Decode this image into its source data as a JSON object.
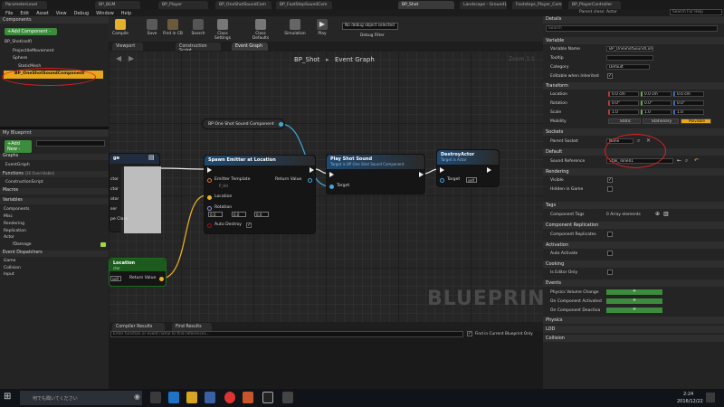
{
  "doc_tabs": [
    {
      "label": "ParameterLevel"
    },
    {
      "label": "BP_BGM"
    },
    {
      "label": "BP_Player"
    },
    {
      "label": "BP_OneShotSoundCom"
    },
    {
      "label": "BP_FootStepSoundCom"
    },
    {
      "label": "BP_Shot"
    },
    {
      "label": "Landscape - Ground1"
    },
    {
      "label": "Footsteps_Player_Comb"
    },
    {
      "label": "BP_PlayerController"
    }
  ],
  "parent_class": "Parent class: Actor",
  "search_placeholder": "Search For Help",
  "menu": [
    "File",
    "Edit",
    "Asset",
    "View",
    "Debug",
    "Window",
    "Help"
  ],
  "components_panel": {
    "title": "Components",
    "add_label": "+Add Component -",
    "root_label": "BP_Shot(self)",
    "items": [
      "ProjectileMovement",
      "Sphere",
      "StaticMesh",
      "BP_OneShotSoundComponent"
    ]
  },
  "my_blueprint": {
    "title": "My Blueprint",
    "add_label": "+Add New -",
    "graphs_label": "Graphs",
    "event_graph": "EventGraph",
    "functions_label": "Functions",
    "functions_note": "(26 Overridable)",
    "construction_script": "ConstructionScript",
    "macros_label": "Macros",
    "variables_label": "Variables",
    "var_categories": [
      "Components",
      "Misc",
      "Rendering",
      "Replication",
      "Actor"
    ],
    "var_item": "fDamage",
    "event_dispatchers_label": "Event Dispatchers",
    "ed_categories": [
      "Game",
      "Collision",
      "Input"
    ]
  },
  "toolbar": [
    {
      "label": "Compile"
    },
    {
      "label": "Save"
    },
    {
      "label": "Find in CB"
    },
    {
      "label": "Search"
    },
    {
      "label": "Class Settings"
    },
    {
      "label": "Class Defaults"
    },
    {
      "label": "Simulation"
    },
    {
      "label": "Play"
    }
  ],
  "debug_select": "No debug object selected",
  "debug_filter": "Debug Filter",
  "graph_tabs": [
    "Viewport",
    "Construction Script",
    "Event Graph"
  ],
  "breadcrumb": {
    "blueprint": "BP_Shot",
    "graph": "Event Graph"
  },
  "zoom_label": "Zoom 1:1",
  "watermark": "BLUEPRINT",
  "nodes": {
    "var_node": "BP One Shot Sound Component",
    "spawn": {
      "title": "Spawn Emitter at Location",
      "template_label": "Emitter Template",
      "template_value": "P_Hit",
      "return_label": "Return Value",
      "location_label": "Location",
      "rotation_label": "Rotation",
      "rotation_values": [
        "0.0",
        "0.0",
        "0.0"
      ],
      "auto_destroy_label": "Auto Destroy"
    },
    "play_shot": {
      "title": "Play Shot Sound",
      "subtitle": "Target is BP One Shot Sound Component",
      "target_label": "Target"
    },
    "destroy": {
      "title": "DestroyActor",
      "subtitle": "Target is Actor",
      "target_label": "Target",
      "target_value": "self"
    },
    "left_node": {
      "title_fragment": "ge",
      "pins": [
        "ctor",
        "ctor",
        "otor",
        "ser",
        "pe Class"
      ]
    },
    "get_location": {
      "title_fragment": "Location",
      "subtitle_fragment": "ctor",
      "self_label": "self",
      "return_label": "Return Value"
    }
  },
  "bottom_tabs": [
    "Compiler Results",
    "Find Results"
  ],
  "find_placeholder": "Enter function or event name to find references...",
  "find_current_label": "Find in Current Blueprint Only",
  "details": {
    "title": "Details",
    "search_placeholder": "Search",
    "sections": {
      "variable": "Variable",
      "transform": "Transform",
      "sockets": "Sockets",
      "default": "Default",
      "rendering": "Rendering",
      "tags": "Tags",
      "component_replication": "Component Replication",
      "activation": "Activation",
      "cooking": "Cooking",
      "events": "Events",
      "physics": "Physics",
      "lod": "LOD",
      "collision": "Collision"
    },
    "variable_name_label": "Variable Name",
    "variable_name_value": "BP_OneShotSoundCom",
    "tooltip_label": "Tooltip",
    "category_label": "Category",
    "category_value": "Default",
    "editable_label": "Editable when Inherited",
    "location_label": "Location",
    "rotation_label": "Rotation",
    "scale_label": "Scale",
    "mobility_label": "Mobility",
    "location_values": [
      "0.0 cm",
      "0.0 cm",
      "0.0 cm"
    ],
    "rotation_values": [
      "0.0°",
      "0.0°",
      "0.0°"
    ],
    "scale_values": [
      "1.0",
      "1.0",
      "1.0"
    ],
    "mobility_options": [
      "Static",
      "Stationary",
      "Movable"
    ],
    "parent_socket_label": "Parent Socket",
    "parent_socket_value": "None",
    "sound_reference_label": "Sound Reference",
    "sound_reference_value": "Stak_Tone01",
    "visible_label": "Visible",
    "hidden_label": "Hidden in Game",
    "component_tags_label": "Component Tags",
    "component_tags_value": "0 Array elements",
    "replicates_label": "Component Replicates",
    "auto_activate_label": "Auto Activate",
    "editor_only_label": "Is Editor Only",
    "event_rows": [
      "Physics Volume Change",
      "On Component Activated",
      "On Component Deactiva"
    ],
    "plus_symbol": "+"
  },
  "taskbar": {
    "search_placeholder": "何でも聞いてください",
    "time": "2:24",
    "date": "2016/12/22"
  }
}
